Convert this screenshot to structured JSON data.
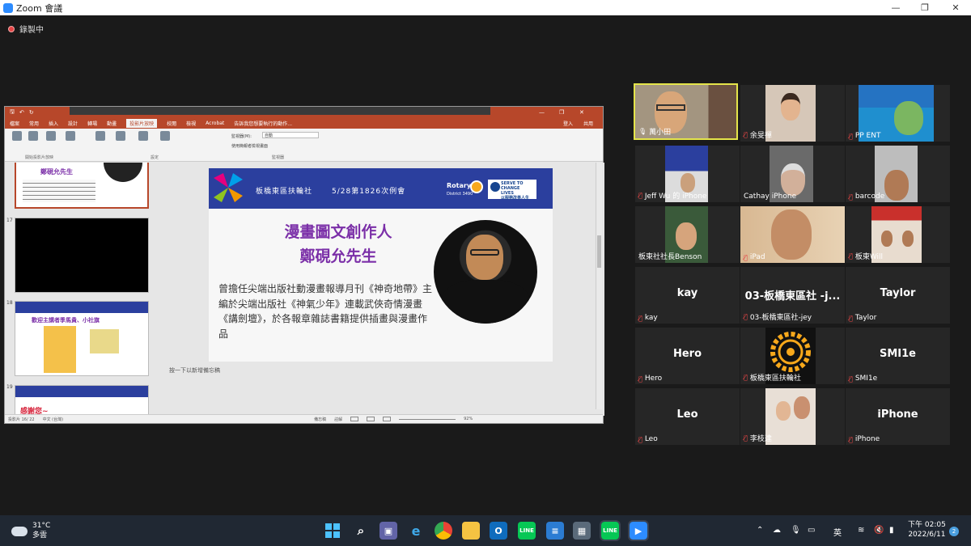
{
  "window": {
    "title": "Zoom 會議",
    "minimize": "—",
    "maximize": "❐",
    "close": "✕"
  },
  "recording": {
    "label": "錄製中"
  },
  "ppt": {
    "tabs": [
      "檔案",
      "常用",
      "插入",
      "設計",
      "轉場",
      "動畫",
      "投影片放映",
      "校閱",
      "檢視",
      "Acrobat",
      "告訴我您想要執行的動作..."
    ],
    "active_tab": "投影片放映",
    "user": "登入",
    "share": "共用",
    "ribbon_groups": [
      "開始投影片放映",
      "設定",
      "監視器"
    ],
    "monitor_label": "監視器(M):",
    "monitor_value": "自動",
    "presenter_view": "使用簡報者檢視畫面",
    "thumbnails": [
      {
        "num": "",
        "title": "鄭硯允先生"
      },
      {
        "num": "17",
        "title": ""
      },
      {
        "num": "18",
        "title": "歡迎主講者季馬貴、小社旗"
      },
      {
        "num": "19",
        "title": "感謝您~"
      }
    ],
    "slide": {
      "club": "板橋東區扶輪社",
      "meeting": "5/28第1826次例會",
      "rotary": "Rotary",
      "district": "District 3490",
      "serve": "SERVE TO CHANGE LIVES",
      "serve_zh": "以服務改善人生",
      "title1": "漫畫圖文創作人",
      "title2": "鄭硯允先生",
      "body": "曾擔任尖端出版社動漫畫報導月刊《神奇地帶》主編於尖端出版社《神氣少年》連載武俠奇情漫畫《講劍壇》，於各報章雜誌書籍提供插畫與漫畫作品"
    },
    "notes": "按一下以新增備忘稿",
    "status_left": "投影片 16/ 22",
    "status_lang": "中文 (台灣)",
    "status_notes": "備忘稿",
    "status_comments": "註解",
    "zoom": "92%"
  },
  "gallery": [
    {
      "name": "萬小田",
      "type": "video",
      "mic": "on",
      "active": true
    },
    {
      "name": "余旻禪",
      "type": "video",
      "mic": "muted"
    },
    {
      "name": "PP ENT",
      "type": "video",
      "mic": "muted"
    },
    {
      "name": "Jeff Wu 的 iPhone",
      "type": "video",
      "mic": "muted"
    },
    {
      "name": "Cathay iPhone",
      "type": "video",
      "mic": "none"
    },
    {
      "name": "barcode",
      "type": "video",
      "mic": "muted"
    },
    {
      "name": "板東社社長Benson",
      "type": "video",
      "mic": "none"
    },
    {
      "name": "iPad",
      "type": "video",
      "mic": "muted"
    },
    {
      "name": "板東Will",
      "type": "video",
      "mic": "muted"
    },
    {
      "name": "kay",
      "big": "kay",
      "type": "name",
      "mic": "muted"
    },
    {
      "name": "03-板橋東區社-jey",
      "big": "03-板橋東區社 -j...",
      "type": "name",
      "mic": "muted"
    },
    {
      "name": "Taylor",
      "big": "Taylor",
      "type": "name",
      "mic": "muted"
    },
    {
      "name": "Hero",
      "big": "Hero",
      "type": "name",
      "mic": "muted"
    },
    {
      "name": "板橋東區扶輪社",
      "type": "video",
      "mic": "muted"
    },
    {
      "name": "SMI1e",
      "big": "SMI1e",
      "type": "name",
      "mic": "muted"
    },
    {
      "name": "Leo",
      "big": "Leo",
      "type": "name",
      "mic": "muted"
    },
    {
      "name": "李枝達",
      "type": "video",
      "mic": "muted"
    },
    {
      "name": "iPhone",
      "big": "iPhone",
      "type": "name",
      "mic": "muted"
    }
  ],
  "taskbar": {
    "temp": "31°C",
    "weather": "多雲",
    "time": "下午 02:05",
    "date": "2022/6/11",
    "notifications": "2",
    "ime": "英"
  },
  "colors": {
    "ppt_accent": "#b7472a",
    "active_speaker": "#e4e44a",
    "muted_mic": "#e64545",
    "slide_banner": "#2b3f9e",
    "slide_title": "#7b2fa8"
  }
}
